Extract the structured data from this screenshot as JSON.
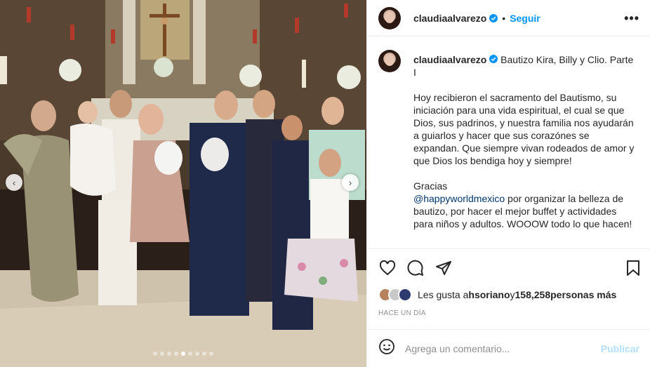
{
  "post": {
    "username": "claudiaalvarezo",
    "follow_label": "Seguir",
    "separator": "•",
    "more_label": "•••",
    "caption": {
      "title": "Bautizo Kira, Billy y Clio. Parte I",
      "paragraph1": "Hoy recibieron el sacramento del Bautismo, su iniciación para una vida espiritual, el cual se que Dios, sus padrinos, y nuestra familia nos ayudarán a guiarlos y hacer que sus corazónes se expandan. Que siempre vivan rodeados de amor y que Dios los bendiga hoy y siempre!",
      "gracias": "Gracias",
      "mention": "@happyworldmexico",
      "paragraph2_rest": " por organizar la belleza de bautizo, por hacer el mejor buffet y actividades para niños y adultos. WOOOW todo lo que hacen!"
    },
    "likes": {
      "prefix": "Les gusta a ",
      "liker": "hsoriano",
      "middle": " y ",
      "count": "158,258",
      "suffix": " personas más"
    },
    "time": "HACE UN DÍA",
    "comment_placeholder": "Agrega un comentario...",
    "publish_label": "Publicar"
  },
  "carousel": {
    "prev_label": "‹",
    "next_label": "›",
    "slide_count": 9,
    "active_index": 4
  },
  "icons": {
    "verified": "verified-badge-icon",
    "like": "heart-icon",
    "comment": "comment-bubble-icon",
    "share": "paper-plane-icon",
    "save": "bookmark-icon",
    "emoji": "smiley-icon"
  },
  "colors": {
    "link_blue": "#0095f6",
    "mention": "#00376b",
    "muted": "#8e8e8e",
    "publish_disabled": "#b2dffc"
  }
}
